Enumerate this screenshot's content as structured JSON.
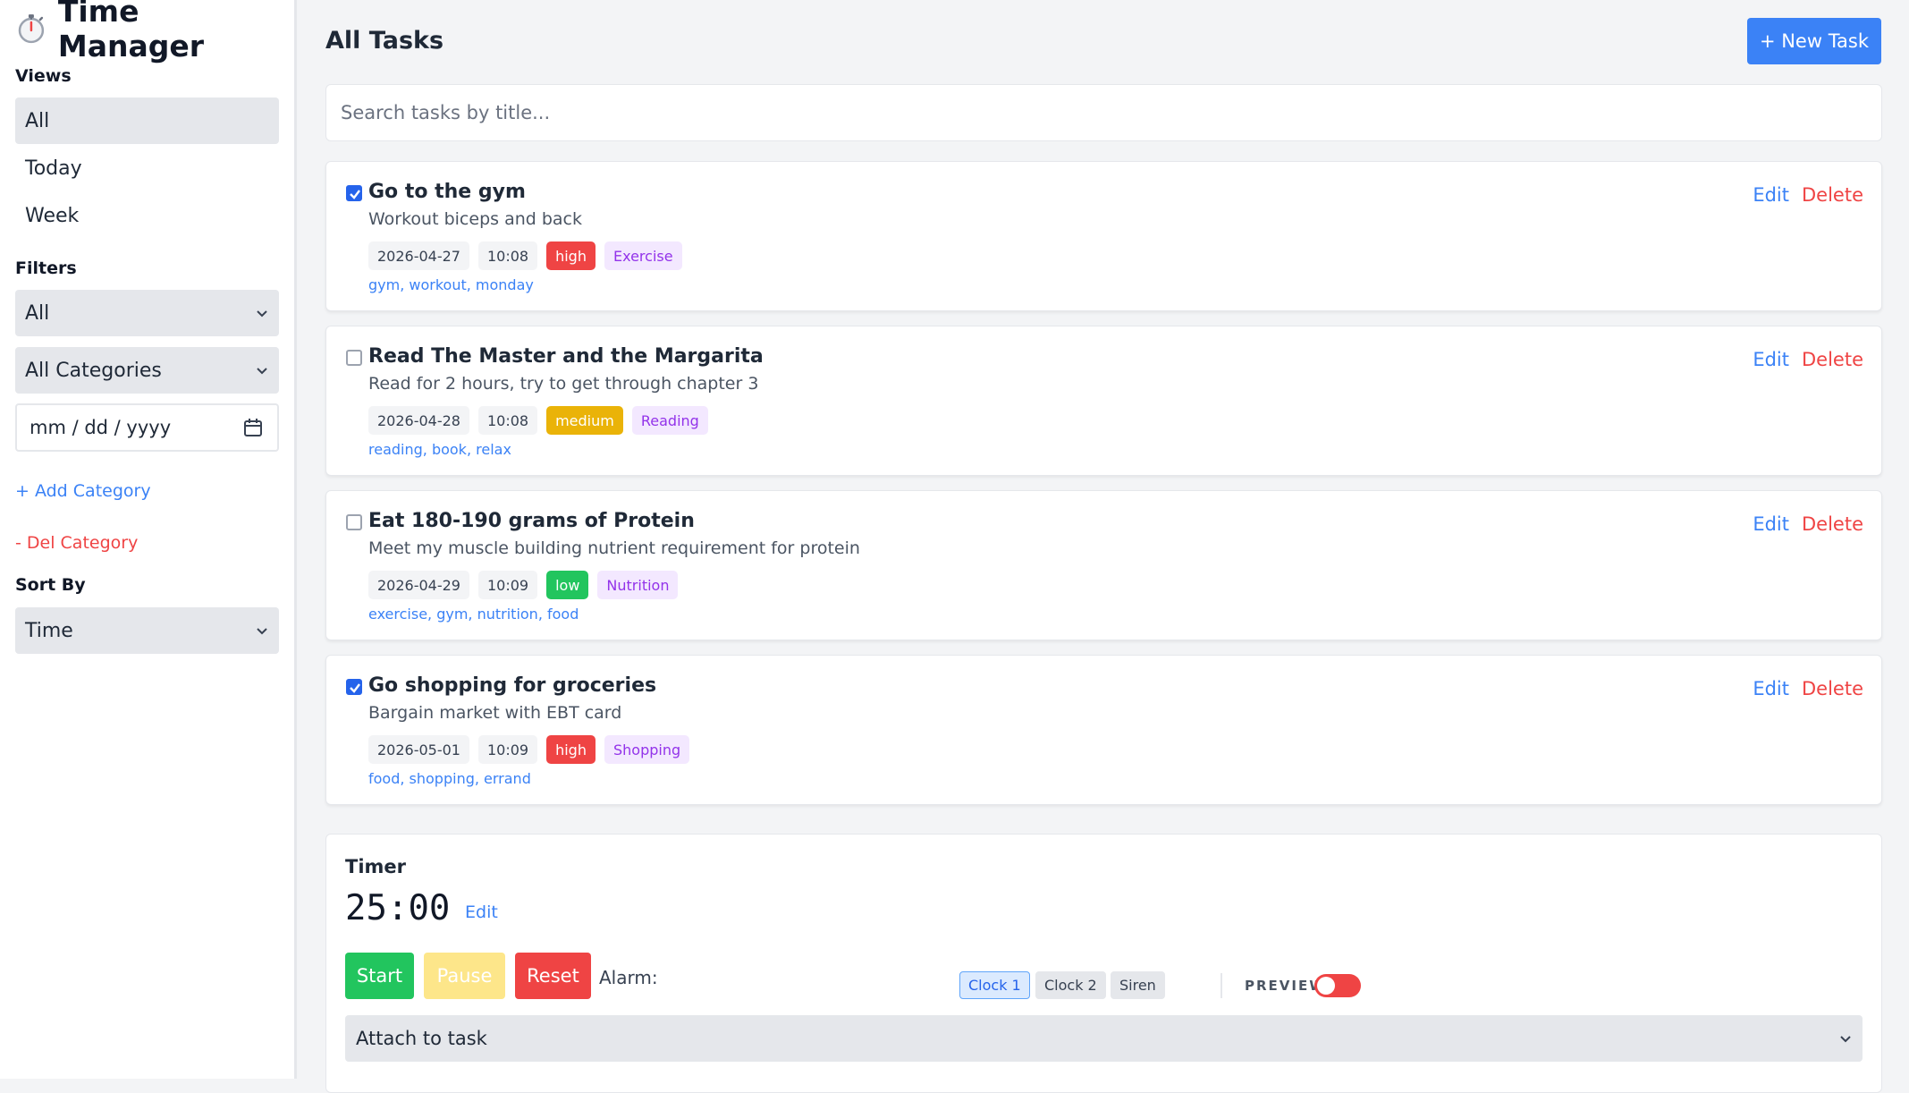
{
  "app": {
    "title": "Time Manager",
    "icon": "stopwatch-icon"
  },
  "sidebar": {
    "views_label": "Views",
    "views": [
      {
        "label": "All",
        "active": true
      },
      {
        "label": "Today",
        "active": false
      },
      {
        "label": "Week",
        "active": false
      }
    ],
    "filters_label": "Filters",
    "status_filter": "All",
    "category_filter": "All Categories",
    "date_placeholder": "mm / dd / yyyy",
    "add_category": "+ Add Category",
    "del_category": "- Del Category",
    "sort_label": "Sort By",
    "sort_value": "Time"
  },
  "main": {
    "title": "All Tasks",
    "new_task_label": "+ New Task",
    "search_placeholder": "Search tasks by title...",
    "edit_label": "Edit",
    "delete_label": "Delete"
  },
  "tasks": [
    {
      "done": true,
      "title": "Go to the gym",
      "description": "Workout biceps and back",
      "date": "2026-04-27",
      "time": "10:08",
      "priority": "high",
      "category": "Exercise",
      "tags": "gym, workout, monday"
    },
    {
      "done": false,
      "title": "Read The Master and the Margarita",
      "description": "Read for 2 hours, try to get through chapter 3",
      "date": "2026-04-28",
      "time": "10:08",
      "priority": "medium",
      "category": "Reading",
      "tags": "reading, book, relax"
    },
    {
      "done": false,
      "title": "Eat 180-190 grams of Protein",
      "description": "Meet my muscle building nutrient requirement for protein",
      "date": "2026-04-29",
      "time": "10:09",
      "priority": "low",
      "category": "Nutrition",
      "tags": "exercise, gym, nutrition, food"
    },
    {
      "done": true,
      "title": "Go shopping for groceries",
      "description": "Bargain market with EBT card",
      "date": "2026-05-01",
      "time": "10:09",
      "priority": "high",
      "category": "Shopping",
      "tags": "food, shopping, errand"
    }
  ],
  "timer": {
    "title": "Timer",
    "display": "25:00",
    "edit_label": "Edit",
    "start_label": "Start",
    "pause_label": "Pause",
    "reset_label": "Reset",
    "alarm_label": "Alarm:",
    "alarms": [
      "Clock 1",
      "Clock 2",
      "Siren"
    ],
    "selected_alarm": "Clock 1",
    "preview_label": "PREVIEW",
    "preview_on": false,
    "attach_placeholder": "Attach to task"
  },
  "colors": {
    "accent": "#3b82f6",
    "danger": "#ef4444",
    "success": "#22c55e",
    "warning": "#eab308",
    "category_bg": "#f3e8ff",
    "category_text": "#9333ea"
  }
}
